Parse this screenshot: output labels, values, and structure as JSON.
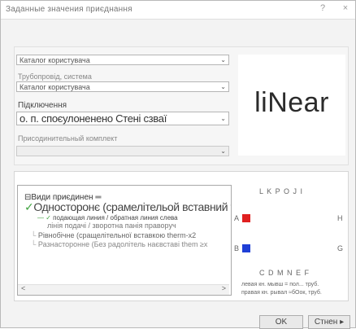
{
  "dialog": {
    "title": "Заданные значения приєднання",
    "help_glyph": "?",
    "close_glyph": "×"
  },
  "top": {
    "catalog_value": "Каталог користувача",
    "pipe_label": "Трубопровід, система",
    "pipe_value": "Каталог користувача",
    "conn_label": "Підключення",
    "conn_value": "о. п. споєулоненено Стені сзваї",
    "fitting_label": "Присодинительный комплект",
    "fitting_value": "",
    "preview_logo": "liNear",
    "dropdown_arrow": "⌄"
  },
  "tree": {
    "root": "Види приєдинен ═",
    "one_side": "Односторонє (срамелітельой вставний them)",
    "sub1": "подающая линия / обратная линия слева",
    "sub2": "лінія подачі / зворотна панія праворуч",
    "opt2": "Рівнобічне (сращелітельної вставкою therm-x2",
    "opt3": "Разнасторонне (Без радолітель наєвставі them ≥x",
    "scroll_left": "<",
    "scroll_right": ">"
  },
  "diagram": {
    "top_letters": "L K   P O   J I",
    "bottom_letters": "C D   M N   E F",
    "label_a": "A",
    "label_b": "B",
    "label_h": "H",
    "label_g": "G",
    "note_line1": "левая кн. мывш = пол... труб.",
    "note_line2": "правая кн. рывал ≈бОок, труб.",
    "red": "#e02020",
    "blue": "#1f3fd6"
  },
  "buttons": {
    "ok": "OK",
    "cancel": "Стнен ▸"
  }
}
